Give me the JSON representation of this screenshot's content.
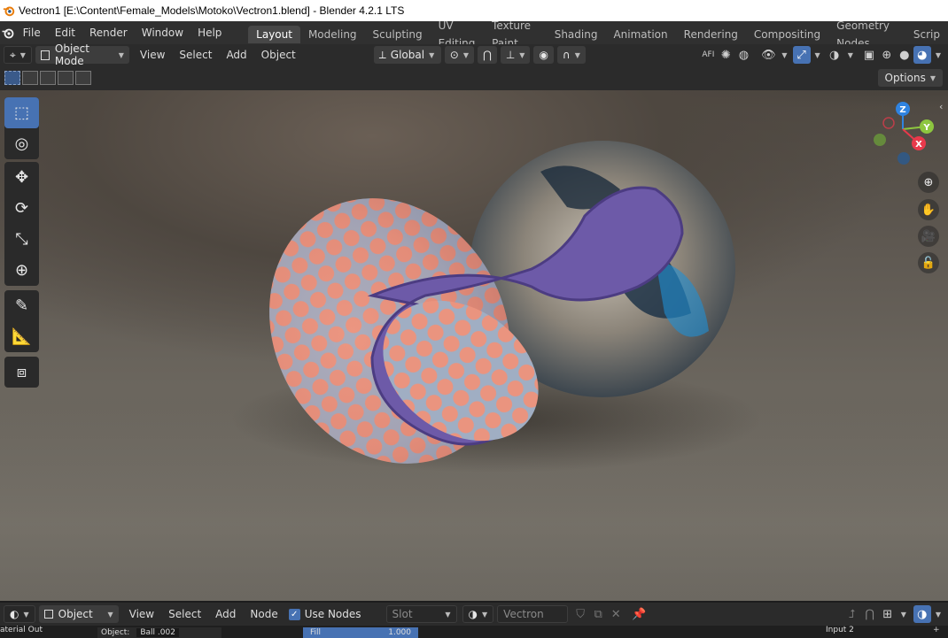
{
  "window": {
    "title": "Vectron1 [E:\\Content\\Female_Models\\Motoko\\Vectron1.blend] - Blender 4.2.1 LTS"
  },
  "topbar": {
    "menus": [
      "File",
      "Edit",
      "Render",
      "Window",
      "Help"
    ],
    "workspaces": [
      "Layout",
      "Modeling",
      "Sculpting",
      "UV Editing",
      "Texture Paint",
      "Shading",
      "Animation",
      "Rendering",
      "Compositing",
      "Geometry Nodes",
      "Scrip"
    ],
    "active_workspace": "Layout"
  },
  "viewport_header": {
    "mode": "Object Mode",
    "menus": [
      "View",
      "Select",
      "Add",
      "Object"
    ],
    "orientation": "Global"
  },
  "viewport": {
    "options_label": "Options",
    "gizmo": {
      "z": "Z",
      "y": "Y",
      "x": "X"
    }
  },
  "bottom_header": {
    "editor": "Object",
    "menus": [
      "View",
      "Select",
      "Add",
      "Node"
    ],
    "use_nodes_label": "Use Nodes",
    "use_nodes_checked": true,
    "slot_label": "Slot",
    "material_name": "Vectron"
  },
  "bottom_strip": {
    "left_text": "aterial Out",
    "object_label": "Object:",
    "object_value": "Ball .002",
    "fill_label": "Fill",
    "fill_value": "1.000",
    "input_label": "Input 2"
  },
  "colors": {
    "accent": "#4772b3",
    "axis_x": "#e8394b",
    "axis_y": "#8dc63f",
    "axis_z": "#2f83e0"
  }
}
